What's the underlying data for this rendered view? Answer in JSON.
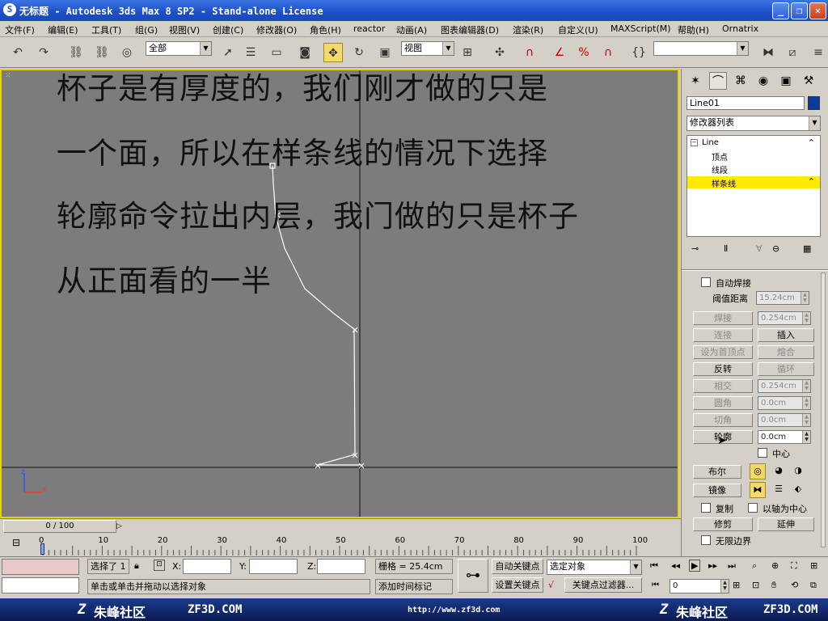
{
  "title": "无标题 - Autodesk 3ds Max 8 SP2  - Stand-alone License",
  "menu": [
    "文件(F)",
    "编辑(E)",
    "工具(T)",
    "组(G)",
    "视图(V)",
    "创建(C)",
    "修改器(O)",
    "角色(H)",
    "reactor",
    "动画(A)",
    "图表编辑器(D)",
    "渲染(R)",
    "自定义(U)",
    "MAXScript(M)",
    "帮助(H)",
    "Ornatrix"
  ],
  "toolbar": {
    "selection_filter": "全部",
    "ref_coord": "视图",
    "named_selection": ""
  },
  "overlay_text": [
    "杯子是有厚度的，我们刚才做的只是",
    "一个面，所以在样条线的情况下选择",
    "轮廓命令拉出内层，我门做的只是杯子",
    "从正面看的一半"
  ],
  "viewport": {
    "axis_labels": {
      "y": "z",
      "x": "x"
    }
  },
  "command_panel": {
    "object_name": "Line01",
    "modifier_list": "修改器列表",
    "stack": {
      "root": "Line",
      "items": [
        "顶点",
        "线段",
        "样条线"
      ],
      "selected": "样条线"
    },
    "auto_weld": "自动焊接",
    "threshold_label": "阈值距离",
    "threshold_value": "15.24cm",
    "rows": [
      {
        "left": "焊接",
        "right_spin": "0.254cm"
      },
      {
        "left": "连接",
        "right_btn": "插入"
      },
      {
        "left": "设为首顶点",
        "right_btn": "熔合"
      },
      {
        "left": "反转",
        "right_btn": "循环"
      },
      {
        "left": "相交",
        "right_spin": "0.254cm"
      },
      {
        "left": "圆角",
        "right_spin": "0.0cm"
      },
      {
        "left": "切角",
        "right_spin": "0.0cm"
      },
      {
        "left": "轮廓",
        "right_spin": "0.0cm"
      }
    ],
    "center_label": "中心",
    "boolean": "布尔",
    "mirror": "镜像",
    "copy": "复制",
    "axis_center": "以轴为中心",
    "trim": "修剪",
    "extend": "延伸",
    "infinite_bounds": "无限边界"
  },
  "time_slider": {
    "label": "0 / 100",
    "current": 0,
    "max": 100
  },
  "ruler_ticks": [
    "0",
    "10",
    "20",
    "30",
    "40",
    "50",
    "60",
    "70",
    "80",
    "90",
    "100"
  ],
  "status": {
    "selected": "选择了 1",
    "x_label": "X:",
    "y_label": "Y:",
    "z_label": "Z:",
    "grid": "栅格 = 25.4cm",
    "auto_key": "自动关键点",
    "set_key": "设置关键点",
    "key_mode": "选定对象",
    "key_filter": "关键点过滤器...",
    "frame": "0",
    "prompt": "单击或单击并拖动以选择对象",
    "add_time_tag": "添加时间标记"
  },
  "footer": {
    "left_brand": "朱峰社区",
    "left_domain": "ZF3D.COM",
    "url": "http://www.zf3d.com",
    "right_brand": "朱峰社区",
    "right_domain": "ZF3D.COM"
  },
  "colors": {
    "viewport_bg": "#7c7c7c",
    "viewport_border": "#e8d300",
    "selection_yellow": "#ffea00",
    "title_blue": "#1c4fc6"
  }
}
